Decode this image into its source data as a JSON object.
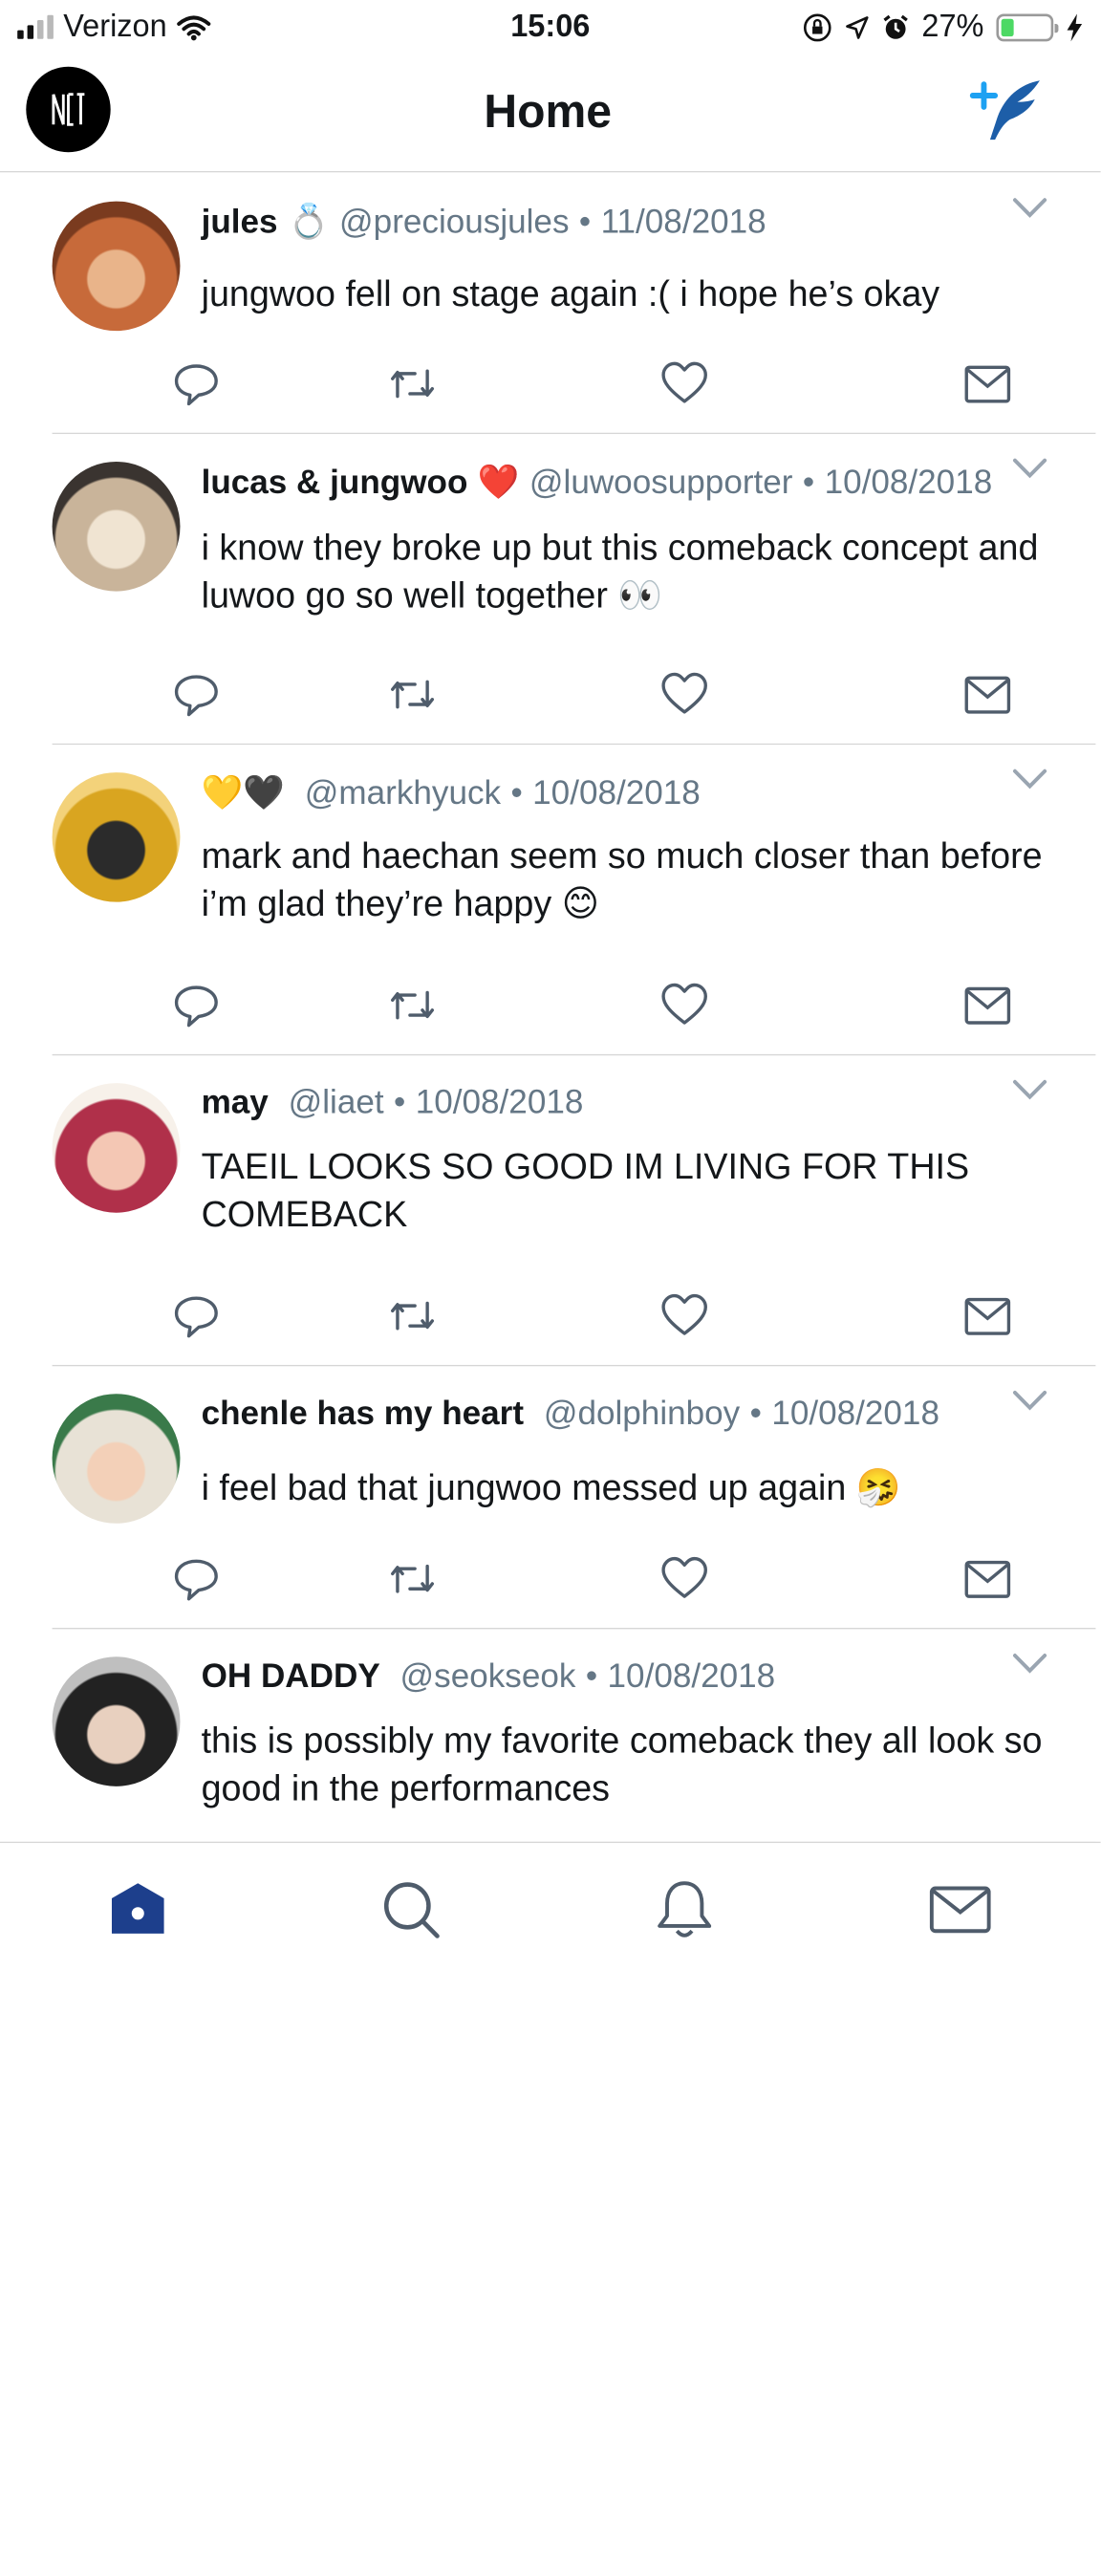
{
  "status_bar": {
    "carrier": "Verizon",
    "time": "15:06",
    "battery_percent": "27%",
    "battery_level": 0.27,
    "icons": [
      "signal-icon",
      "wifi-icon",
      "orientation-lock-icon",
      "location-icon",
      "alarm-icon",
      "battery-icon",
      "charging-bolt-icon"
    ]
  },
  "header": {
    "title": "Home",
    "logo": "nct-logo",
    "compose_icon": "compose-tweet-icon"
  },
  "colors": {
    "accent": "#1d3f8c",
    "muted": "#657786",
    "text": "#14171a",
    "divider": "#d6d6d6"
  },
  "tweets": [
    {
      "name": "jules",
      "name_emoji": "💍",
      "handle": "@preciousjules",
      "dot": "•",
      "date": "11/08/2018",
      "text": "jungwoo fell on stage again :( i hope he’s okay"
    },
    {
      "name": "lucas & jungwoo",
      "name_emoji": "❤️",
      "handle": "@luwoosupporter",
      "dot": "•",
      "date": "10/08/2018",
      "text": "i know they broke up but this comeback concept and luwoo go so well together 👀"
    },
    {
      "name": "💛🖤",
      "name_emoji": "",
      "handle": "@markhyuck",
      "dot": "•",
      "date": "10/08/2018",
      "text": "mark and haechan seem so much closer than before i’m glad they’re happy 😊"
    },
    {
      "name": "may",
      "name_emoji": "",
      "handle": "@liaet",
      "dot": "•",
      "date": "10/08/2018",
      "text": "TAEIL LOOKS SO GOOD IM LIVING FOR THIS COMEBACK"
    },
    {
      "name": "chenle has my heart",
      "name_emoji": "",
      "handle": "@dolphinboy",
      "dot": "•",
      "date": "10/08/2018",
      "text": "i feel bad that jungwoo messed up again 🤧"
    },
    {
      "name": "OH DADDY",
      "name_emoji": "",
      "handle": "@seokseok",
      "dot": "•",
      "date": "10/08/2018",
      "text": "this is possibly my favorite comeback they all look so good in the performances"
    }
  ],
  "tweet_actions": [
    "reply-icon",
    "retweet-icon",
    "like-icon",
    "direct-message-icon"
  ],
  "tab_bar": {
    "items": [
      "home-icon",
      "search-icon",
      "notifications-icon",
      "messages-icon"
    ],
    "active": "home-icon"
  }
}
